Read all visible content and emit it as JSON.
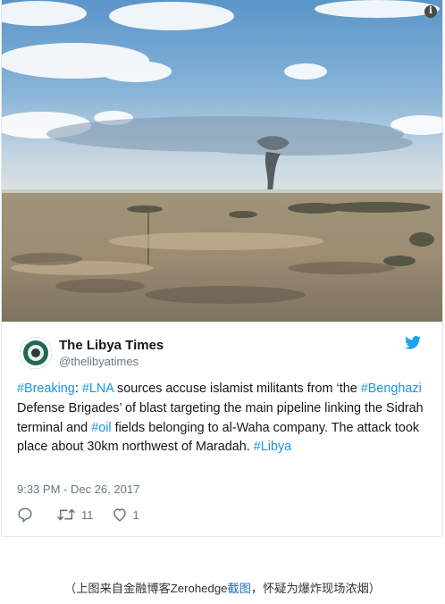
{
  "tweet": {
    "display_name": "The Libya Times",
    "handle": "@thelibyatimes",
    "text_parts": {
      "p1": "#Breaking",
      "p2": ": ",
      "p3": "#LNA",
      "p4": " sources accuse islamist militants from ‘the ",
      "p5": "#Benghazi",
      "p6": " Defense Brigades’ of blast targeting the main pipeline linking the Sidrah terminal and ",
      "p7": "#oil",
      "p8": " fields belonging to al-Waha company. The attack took place about 30km northwest of Maradah. ",
      "p9": "#Libya"
    },
    "timestamp": "9:33 PM - Dec 26, 2017",
    "retweets": "11",
    "likes": "1"
  },
  "photo": {
    "info_label": "i",
    "description_icon": "smoke-plume-landscape"
  },
  "caption": {
    "before": "（上图来自金融博客Zerohedge",
    "link": "截图",
    "after": "，怀疑为爆炸现场浓烟）"
  },
  "colors": {
    "link_blue": "#1b95e0",
    "caption_link": "#1b6ec2",
    "muted": "#657786"
  },
  "icons": [
    "info-icon",
    "twitter-bird-icon",
    "reply-icon",
    "retweet-icon",
    "like-icon"
  ]
}
